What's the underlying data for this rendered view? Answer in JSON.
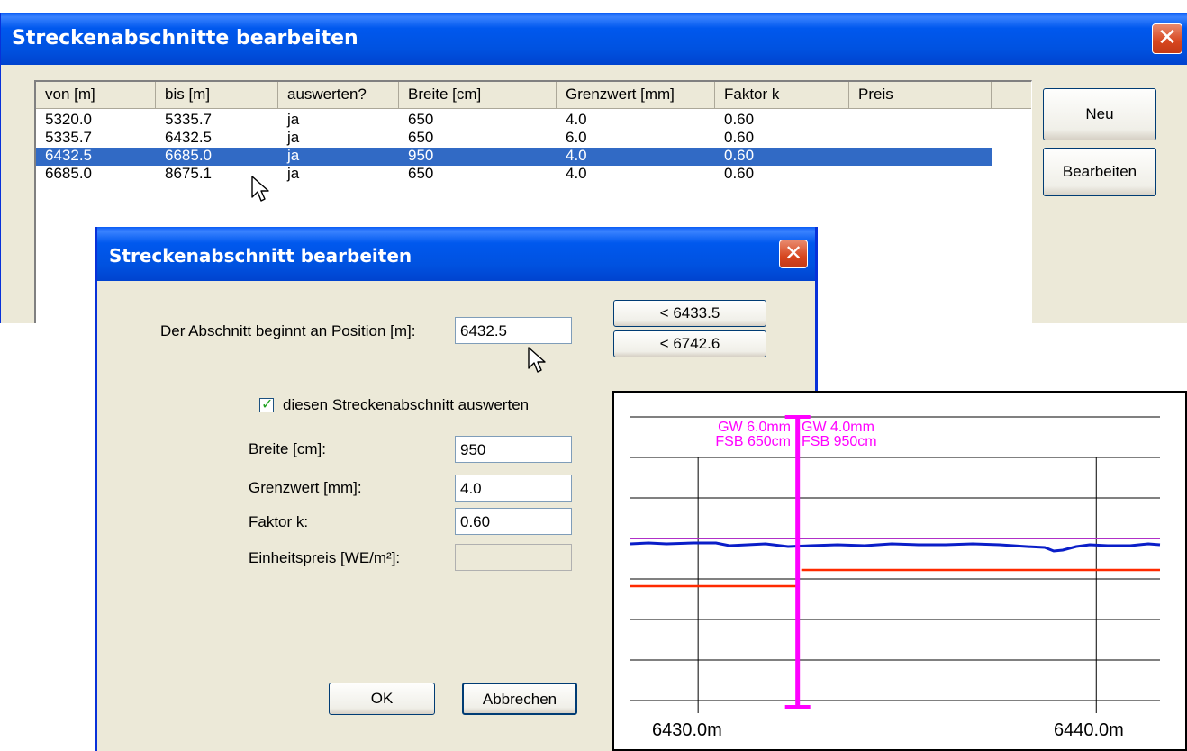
{
  "main_window": {
    "title": "Streckenabschnitte bearbeiten",
    "columns": [
      "von [m]",
      "bis [m]",
      "auswerten?",
      "Breite [cm]",
      "Grenzwert [mm]",
      "Faktor k",
      "Preis"
    ],
    "rows": [
      [
        "5320.0",
        "5335.7",
        "ja",
        "650",
        "4.0",
        "0.60",
        ""
      ],
      [
        "5335.7",
        "6432.5",
        "ja",
        "650",
        "6.0",
        "0.60",
        ""
      ],
      [
        "6432.5",
        "6685.0",
        "ja",
        "950",
        "4.0",
        "0.60",
        ""
      ],
      [
        "6685.0",
        "8675.1",
        "ja",
        "650",
        "4.0",
        "0.60",
        ""
      ]
    ],
    "selected_row": 2,
    "buttons": {
      "new": "Neu",
      "edit": "Bearbeiten"
    },
    "close_icon": "close-icon"
  },
  "dialog": {
    "title": "Streckenabschnitt bearbeiten",
    "start_label": "Der Abschnitt beginnt an Position [m]:",
    "start_value": "6432.5",
    "nav_prev": "<  6433.5",
    "nav_next": "<  6742.6",
    "evaluate_label": "diesen Streckenabschnitt auswerten",
    "evaluate_checked": true,
    "width_label": "Breite [cm]:",
    "width_value": "950",
    "limit_label": "Grenzwert [mm]:",
    "limit_value": "4.0",
    "factor_label": "Faktor k:",
    "factor_value": "0.60",
    "price_label": "Einheitspreis [WE/m²]:",
    "price_value": "",
    "ok": "OK",
    "cancel": "Abbrechen"
  },
  "chart_data": {
    "type": "line",
    "x_tick_labels": [
      "6430.0m",
      "6440.0m"
    ],
    "xlim": [
      6428.3,
      6441.6
    ],
    "marker_x": 6432.5,
    "annotation_left": [
      "GW 6.0mm",
      "FSB 650cm"
    ],
    "annotation_right": [
      "GW 4.0mm",
      "FSB 950cm"
    ],
    "grid": true,
    "colors": {
      "profile": "#0a1ec8",
      "limit": "#ff2a00",
      "reference": "#b030c8",
      "marker": "#ff00ff"
    }
  }
}
